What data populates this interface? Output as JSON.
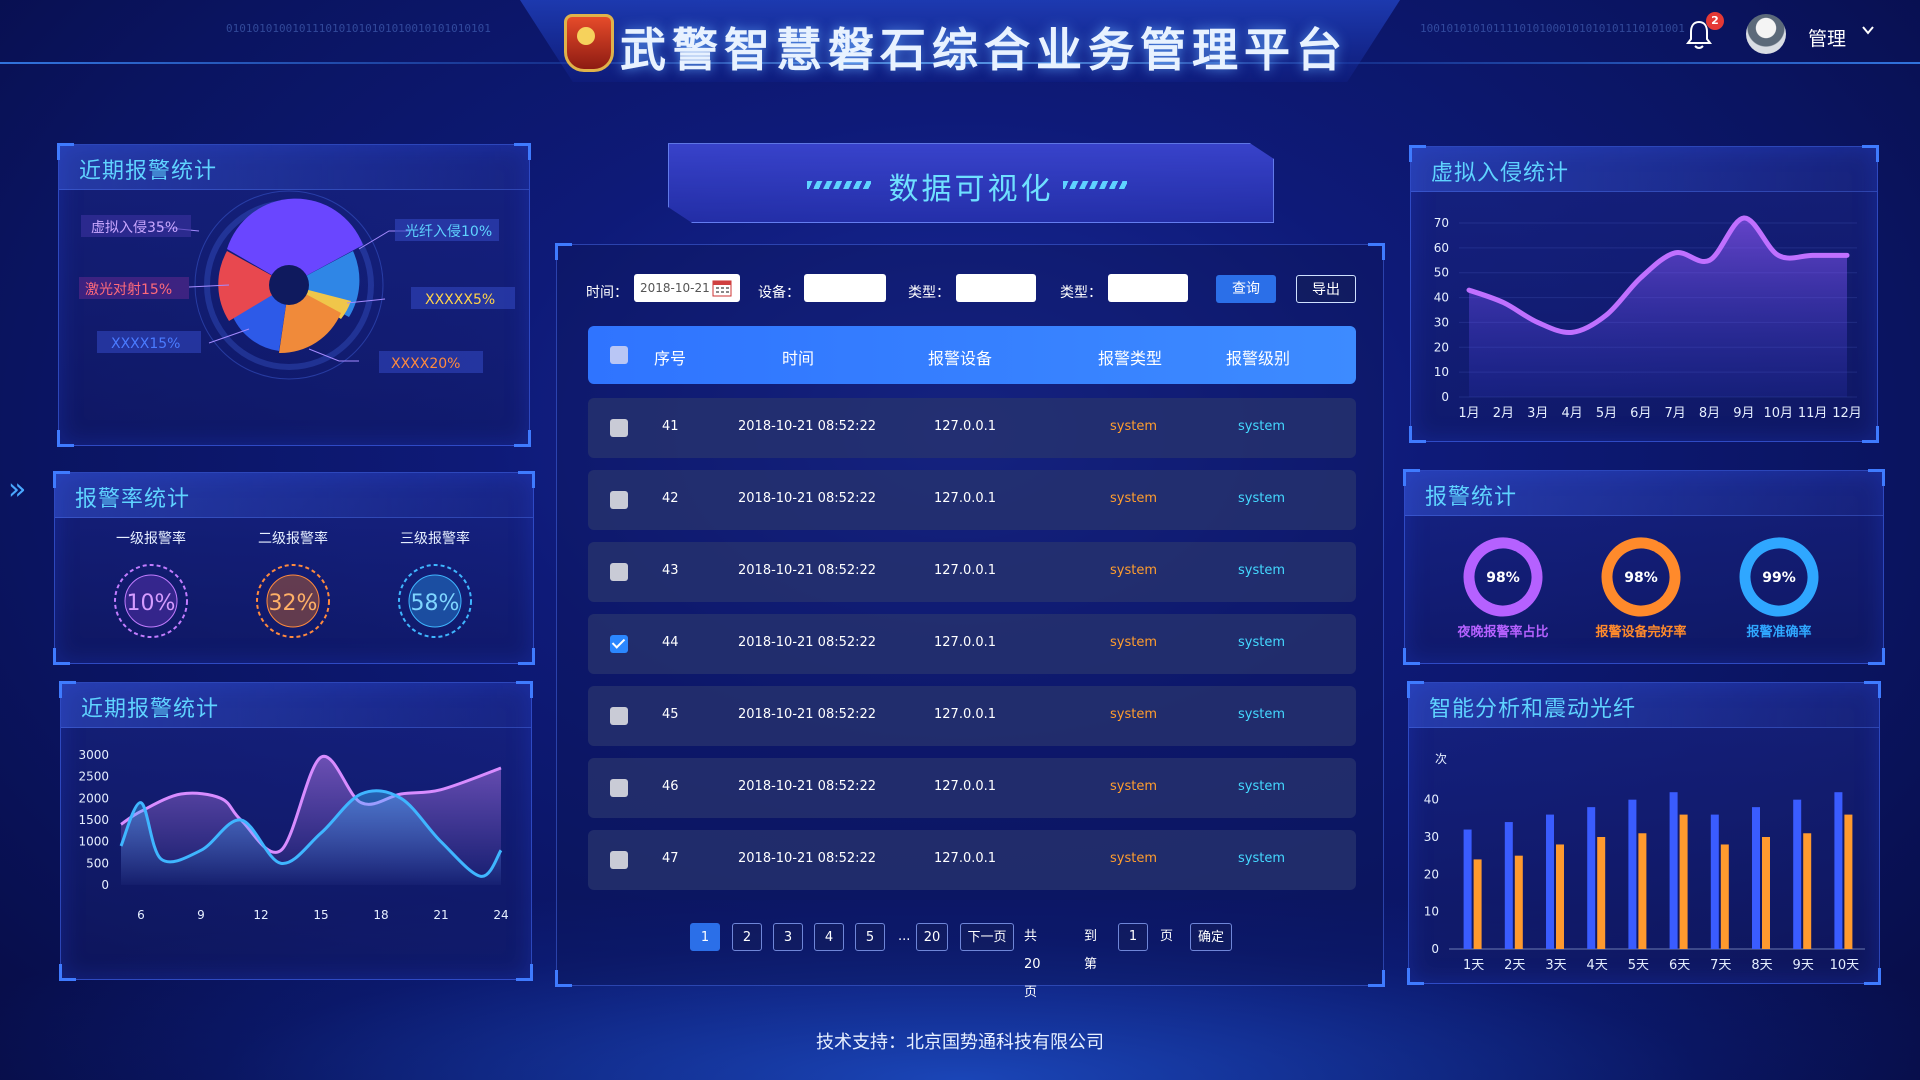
{
  "header": {
    "title": "武警智慧磐石综合业务管理平台",
    "notification_count": "2",
    "user_name": "管理",
    "binary_left": "0101010100101110101010101010010101010101",
    "binary_right": "1001010101011110101000101010101110101001"
  },
  "left_top": {
    "title": "近期报警统计",
    "labels": [
      "虚拟入侵35%",
      "光纤入侵10%",
      "激光对射15%",
      "XXXXX5%",
      "XXXX15%",
      "XXXX20%"
    ]
  },
  "left_mid": {
    "title": "报警率统计",
    "items": [
      {
        "label": "一级报警率",
        "value": "10%",
        "color": "#c27cff"
      },
      {
        "label": "二级报警率",
        "value": "32%",
        "color": "#ff8a3d"
      },
      {
        "label": "三级报警率",
        "value": "58%",
        "color": "#3fb6ff"
      }
    ]
  },
  "left_bottom": {
    "title": "近期报警统计",
    "chart_data": {
      "type": "area",
      "x": [
        6,
        9,
        12,
        15,
        18,
        21,
        24
      ],
      "x_ticks": [
        "6",
        "9",
        "12",
        "15",
        "18",
        "21",
        "24"
      ],
      "y_ticks": [
        "3000",
        "2500",
        "2000",
        "1500",
        "1000",
        "500",
        "0"
      ],
      "ylim": [
        0,
        3000
      ],
      "series": [
        {
          "color": "#d88cff",
          "x": [
            5,
            6,
            8,
            10,
            11,
            13,
            15,
            17,
            19,
            21,
            24
          ],
          "values": [
            1400,
            1700,
            2100,
            2000,
            1500,
            800,
            2950,
            1900,
            2100,
            2200,
            2700
          ]
        },
        {
          "color": "#3fb6ff",
          "x": [
            5,
            6,
            7,
            9,
            11,
            13,
            15,
            17,
            19,
            21,
            23,
            24
          ],
          "values": [
            900,
            1900,
            600,
            800,
            1500,
            500,
            1200,
            2100,
            2000,
            1000,
            200,
            800
          ]
        }
      ]
    }
  },
  "center": {
    "banner_title": "数据可视化",
    "filters": {
      "time_label": "时间：",
      "time_value": "2018-10-21",
      "device_label": "设备：",
      "type_label_1": "类型：",
      "type_label_2": "类型：",
      "query_label": "查询",
      "export_label": "导出"
    },
    "columns": [
      "序号",
      "时间",
      "报警设备",
      "报警类型",
      "报警级别"
    ],
    "rows": [
      {
        "id": "41",
        "time": "2018-10-21 08:52:22",
        "device": "127.0.0.1",
        "type": "system",
        "level": "system",
        "checked": false
      },
      {
        "id": "42",
        "time": "2018-10-21 08:52:22",
        "device": "127.0.0.1",
        "type": "system",
        "level": "system",
        "checked": false
      },
      {
        "id": "43",
        "time": "2018-10-21 08:52:22",
        "device": "127.0.0.1",
        "type": "system",
        "level": "system",
        "checked": false
      },
      {
        "id": "44",
        "time": "2018-10-21 08:52:22",
        "device": "127.0.0.1",
        "type": "system",
        "level": "system",
        "checked": true
      },
      {
        "id": "45",
        "time": "2018-10-21 08:52:22",
        "device": "127.0.0.1",
        "type": "system",
        "level": "system",
        "checked": false
      },
      {
        "id": "46",
        "time": "2018-10-21 08:52:22",
        "device": "127.0.0.1",
        "type": "system",
        "level": "system",
        "checked": false
      },
      {
        "id": "47",
        "time": "2018-10-21 08:52:22",
        "device": "127.0.0.1",
        "type": "system",
        "level": "system",
        "checked": false
      }
    ],
    "pagination": {
      "pages": [
        "1",
        "2",
        "3",
        "4",
        "5"
      ],
      "ellipsis": "...",
      "last_page": "20",
      "next_label": "下一页",
      "total_label": "共20页",
      "goto_label": "到第",
      "goto_value": "1",
      "page_unit": "页",
      "confirm_label": "确定"
    }
  },
  "right_top": {
    "title": "虚拟入侵统计",
    "chart_data": {
      "type": "area",
      "categories": [
        "1月",
        "2月",
        "3月",
        "4月",
        "5月",
        "6月",
        "7月",
        "8月",
        "9月",
        "10月",
        "11月",
        "12月"
      ],
      "y_ticks": [
        "70",
        "60",
        "50",
        "40",
        "30",
        "20",
        "10",
        "0"
      ],
      "ylim": [
        0,
        70
      ],
      "series": [
        {
          "color": "#c070ff",
          "values": [
            43,
            38,
            30,
            26,
            33,
            48,
            58,
            55,
            72,
            57,
            57,
            57
          ]
        }
      ]
    }
  },
  "right_mid": {
    "title": "报警统计",
    "items": [
      {
        "label": "夜晚报警率占比",
        "value": "98%",
        "color": "#b561ff",
        "pct": 0.98
      },
      {
        "label": "报警设备完好率",
        "value": "98%",
        "color": "#ff8a2b",
        "pct": 0.98
      },
      {
        "label": "报警准确率",
        "value": "99%",
        "color": "#2fa7ff",
        "pct": 0.99
      }
    ]
  },
  "right_bottom": {
    "title": "智能分析和震动光纤",
    "chart_data": {
      "type": "bar",
      "categories": [
        "1天",
        "2天",
        "3天",
        "4天",
        "5天",
        "6天",
        "7天",
        "8天",
        "9天",
        "10天"
      ],
      "ylabel": "次",
      "y_ticks": [
        "40",
        "30",
        "20",
        "10",
        "0"
      ],
      "ylim": [
        0,
        40
      ],
      "series": [
        {
          "color": "#3a5cff",
          "values": [
            32,
            34,
            36,
            38,
            40,
            42,
            36,
            38,
            40,
            42
          ]
        },
        {
          "color": "#ff9a2e",
          "values": [
            24,
            25,
            28,
            30,
            31,
            36,
            28,
            30,
            31,
            36
          ]
        }
      ]
    }
  },
  "footer": {
    "text": "技术支持：北京国势通科技有限公司"
  },
  "colors": {
    "accent": "#5fd3ff",
    "table_header": "#2f74ff",
    "type_text": "#ff9d2e",
    "level_text": "#44d8ff"
  }
}
